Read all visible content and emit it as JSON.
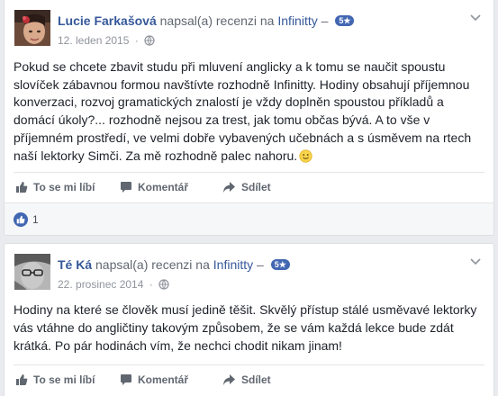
{
  "colors": {
    "page_bg": "#e9ebee",
    "card_bg": "#ffffff",
    "link_blue": "#365899",
    "badge_blue": "#4267b2",
    "meta_gray": "#90949c"
  },
  "reviews": [
    {
      "author": "Lucie Farkašová",
      "action_text": "napsal(a) recenzi na",
      "page_name": "Infinitty",
      "separator": "–",
      "rating_badge": "5★",
      "date": "12. leden 2015",
      "dot": "·",
      "privacy_icon": "globe-icon",
      "text": "Pokud se chcete zbavit studu při mluvení anglicky a k tomu se naučit spoustu slovíček zábavnou formou navštívte rozhodně Infinitty. Hodiny obsahují příjemnou konverzaci, rozvoj gramatických znalostí je vždy doplněn spoustou příkladů a domácí úkoly?... rozhodně nejsou za trest, jak tomu občas bývá. A to vše v příjemném prostředí, ve velmi dobře vybavených učebnách a s úsměvem na rtech naší lektorky Simči. Za mě rozhodně palec nahoru.",
      "actions": {
        "like": "To se mi líbí",
        "comment": "Komentář",
        "share": "Sdílet"
      },
      "like_count": "1"
    },
    {
      "author": "Té Ká",
      "action_text": "napsal(a) recenzi na",
      "page_name": "Infinitty",
      "separator": "–",
      "rating_badge": "5★",
      "date": "22. prosinec 2014",
      "dot": "·",
      "privacy_icon": "globe-icon",
      "text": "Hodiny na které se člověk musí jedině těšit. Skvělý přístup stálé usměvavé lektorky vás vtáhne do angličtiny takovým způsobem, že se vám každá lekce bude zdát krátká. Po pár hodinách vím, že nechci chodit nikam jinam!",
      "actions": {
        "like": "To se mi líbí",
        "comment": "Komentář",
        "share": "Sdílet"
      }
    }
  ]
}
